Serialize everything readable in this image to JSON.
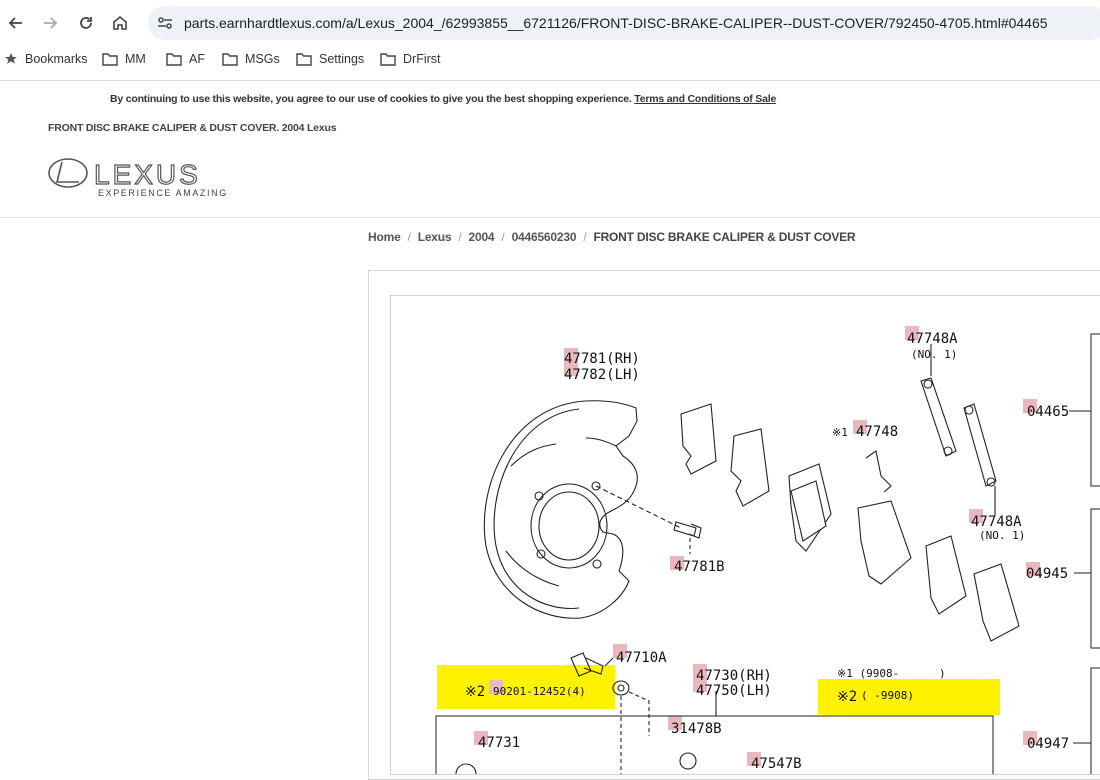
{
  "browser": {
    "url": "parts.earnhardtlexus.com/a/Lexus_2004_/62993855__6721126/FRONT-DISC-BRAKE-CALIPER--DUST-COVER/792450-4705.html#04465",
    "bookmarks": [
      "Bookmarks",
      "MM",
      "AF",
      "MSGs",
      "Settings",
      "DrFirst"
    ]
  },
  "cookie_notice": {
    "text": "By continuing to use this website, you agree to our use of cookies to give you the best shopping experience.",
    "link": "Terms and Conditions of Sale"
  },
  "page_title": "FRONT DISC BRAKE CALIPER & DUST COVER. 2004 Lexus",
  "logo": {
    "word": "LEXUS",
    "tagline": "EXPERIENCE AMAZING"
  },
  "breadcrumb": [
    "Home",
    "Lexus",
    "2004",
    "0446560230",
    "FRONT DISC BRAKE CALIPER & DUST COVER"
  ],
  "diagram": {
    "labels": {
      "p47781": "47781(RH)",
      "p47782": "47782(LH)",
      "p47748A_top": "47748A",
      "no1_top": "(NO. 1)",
      "p04465": "04465",
      "p47748": "47748",
      "mark1": "※1",
      "p47748A_bot": "47748A",
      "no1_bot": "(NO. 1)",
      "p47781B": "47781B",
      "p04945": "04945",
      "p47710A": "47710A",
      "p47730": "47730(RH)",
      "p47750": "47750(LH)",
      "note1": "※1 (9908-",
      "note1_close": ")",
      "note2_mark": "※2",
      "note2": "(      -9908)",
      "bolt_mark": "※2",
      "bolt": "90201-12452(4)",
      "p31478B": "31478B",
      "p04947": "04947",
      "p47731": "47731",
      "p47547B": "47547B"
    }
  }
}
